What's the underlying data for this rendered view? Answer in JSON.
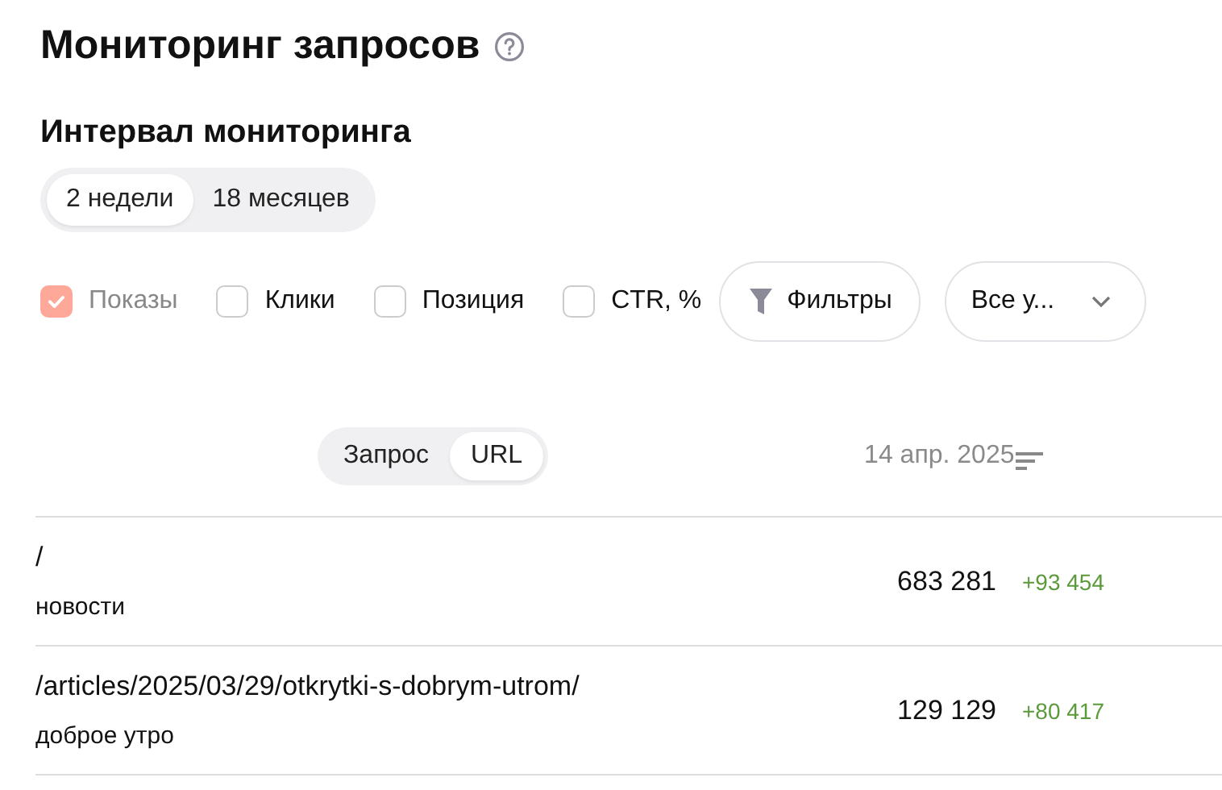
{
  "title": "Мониторинг запросов",
  "interval": {
    "title": "Интервал мониторинга",
    "options": [
      {
        "label": "2 недели",
        "selected": true
      },
      {
        "label": "18 месяцев",
        "selected": false
      }
    ]
  },
  "metrics": [
    {
      "label": "Показы",
      "checked": true,
      "disabled": true
    },
    {
      "label": "Клики",
      "checked": false,
      "disabled": false
    },
    {
      "label": "Позиция",
      "checked": false,
      "disabled": false
    },
    {
      "label": "CTR, %",
      "checked": false,
      "disabled": false
    }
  ],
  "filters_button": "Фильтры",
  "device_select": "Все у...",
  "view_switch": [
    {
      "label": "Запрос",
      "selected": false
    },
    {
      "label": "URL",
      "selected": true
    }
  ],
  "date_column": "14 апр. 2025",
  "rows": [
    {
      "url": "/",
      "query": "новости",
      "value": "683 281",
      "delta": "+93 454"
    },
    {
      "url": "/articles/2025/03/29/otkrytki-s-dobrym-utrom/",
      "query": "доброе утро",
      "value": "129 129",
      "delta": "+80 417"
    }
  ]
}
